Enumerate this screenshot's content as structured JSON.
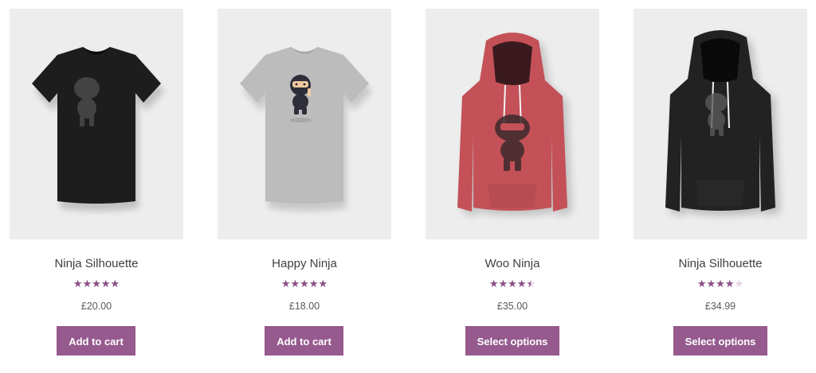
{
  "products": [
    {
      "title": "Ninja Silhouette",
      "price": "£20.00",
      "rating": 5,
      "button": "Add to cart",
      "image": "black-tshirt-ninja-silhouette"
    },
    {
      "title": "Happy Ninja",
      "price": "£18.00",
      "rating": 5,
      "button": "Add to cart",
      "image": "grey-tshirt-happy-ninja"
    },
    {
      "title": "Woo Ninja",
      "price": "£35.00",
      "rating": 4.5,
      "button": "Select options",
      "image": "red-hoodie-woo-ninja"
    },
    {
      "title": "Ninja Silhouette",
      "price": "£34.99",
      "rating": 4,
      "button": "Select options",
      "image": "black-hoodie-ninja-silhouette"
    }
  ],
  "colors": {
    "accent": "#965a8e",
    "star": "#8b4f87",
    "star_empty": "#e7d3e1",
    "thumb_bg": "#ededed"
  }
}
